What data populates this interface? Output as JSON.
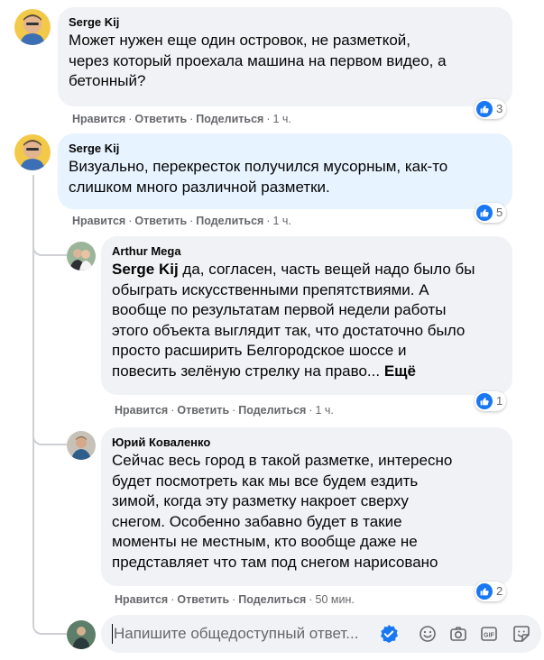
{
  "comments": [
    {
      "author": "Serge Kij",
      "text": "Может нужен еще один островок, не разметкой,\nчерез который проехала машина на первом видео, а\nбетонный?",
      "like_label": "Нравится",
      "reply_label": "Ответить",
      "share_label": "Поделиться",
      "time": "1 ч.",
      "reactions": "3"
    },
    {
      "author": "Serge Kij",
      "text": "Визуально, перекресток получился мусорным, как-то\nслишком много различной разметки.",
      "like_label": "Нравится",
      "reply_label": "Ответить",
      "share_label": "Поделиться",
      "time": "1 ч.",
      "reactions": "5"
    }
  ],
  "replies": [
    {
      "author": "Arthur Mega",
      "mention": "Serge Kij",
      "text": " да, согласен, часть вещей надо было бы\nобыграть искусственными препятствиями. А\nвообще по результатам первой недели работы\nэтого объекта выглядит так, что достаточно было\nпросто расширить Белгородское шоссе и\nповесить зелёную стрелку на право... ",
      "more_label": "Ещё",
      "like_label": "Нравится",
      "reply_label": "Ответить",
      "share_label": "Поделиться",
      "time": "1 ч.",
      "reactions": "1"
    },
    {
      "author": "Юрий Коваленко",
      "text": "Сейчас весь город в такой разметке, интересно\nбудет посмотреть как мы все будем ездить\nзимой, когда эту разметку накроет сверху\nснегом. Особенно забавно будет в такие\nмоменты не местным, кто вообще даже не\nпредставляет что там под снегом нарисовано",
      "like_label": "Нравится",
      "reply_label": "Ответить",
      "share_label": "Поделиться",
      "time": "50 мин.",
      "reactions": "2"
    }
  ],
  "reply_box": {
    "placeholder": "Напишите общедоступный ответ..."
  },
  "icons": {
    "like": "like-icon",
    "emoji": "emoji-icon",
    "camera": "camera-icon",
    "gif": "gif-icon",
    "sticker": "sticker-icon",
    "send": "verified-check-icon"
  },
  "colors": {
    "bubble": "#f0f2f5",
    "bubble_highlight": "#e7f3ff",
    "meta_text": "#65676b",
    "like_blue": "#1877f2"
  }
}
